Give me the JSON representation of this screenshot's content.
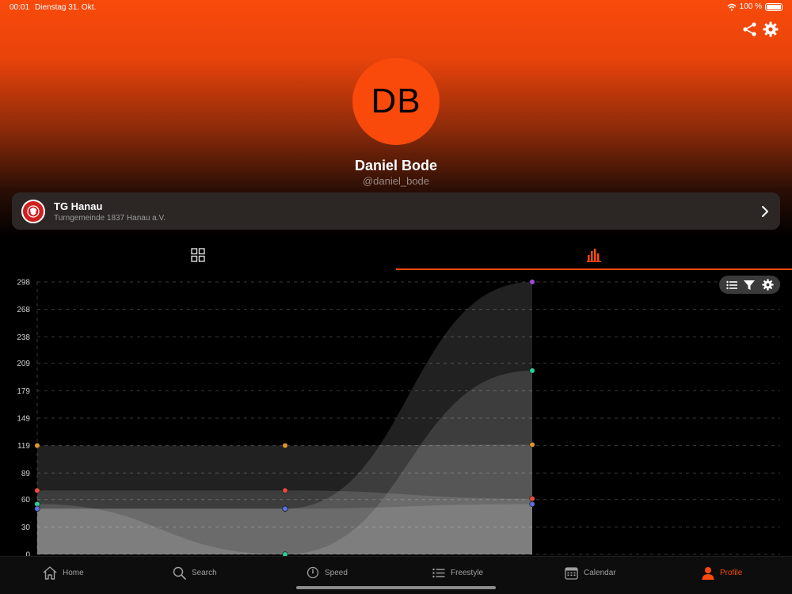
{
  "status": {
    "time": "00:01",
    "date": "Dienstag 31. Okt.",
    "battery": "100 %"
  },
  "profile": {
    "initials": "DB",
    "name": "Daniel Bode",
    "handle": "@daniel_bode"
  },
  "club": {
    "name": "TG Hanau",
    "subtitle": "Turngemeinde 1837 Hanau a.V."
  },
  "tabs": [
    {
      "icon": "grid-icon",
      "active": false
    },
    {
      "icon": "bar-chart-icon",
      "active": true
    }
  ],
  "chart_toolbar": [
    "list-icon",
    "filter-icon",
    "gear-icon"
  ],
  "chart_data": {
    "type": "area",
    "y_ticks": [
      "298",
      "268",
      "238",
      "209",
      "179",
      "149",
      "119",
      "89",
      "60",
      "30",
      "0"
    ],
    "ylim": [
      0,
      298
    ],
    "grid": true,
    "x": [
      0,
      1,
      2
    ],
    "series": [
      {
        "color": "#9b4dd6",
        "values": [
          50,
          50,
          298
        ]
      },
      {
        "color": "#e0952c",
        "values": [
          119,
          119,
          120
        ]
      },
      {
        "color": "#2ecc9a",
        "values": [
          55,
          0,
          201
        ]
      },
      {
        "color": "#e74c3c",
        "values": [
          70,
          70,
          61
        ]
      },
      {
        "color": "#5a6fe0",
        "values": [
          50,
          50,
          55
        ]
      }
    ]
  },
  "nav": {
    "items": [
      {
        "label": "Home",
        "icon": "home-icon",
        "active": false
      },
      {
        "label": "Search",
        "icon": "search-icon",
        "active": false
      },
      {
        "label": "Speed",
        "icon": "stopwatch-icon",
        "active": false
      },
      {
        "label": "Freestyle",
        "icon": "list-icon",
        "active": false
      },
      {
        "label": "Calendar",
        "icon": "calendar-icon",
        "active": false
      },
      {
        "label": "Profile",
        "icon": "person-icon",
        "active": true
      }
    ]
  }
}
